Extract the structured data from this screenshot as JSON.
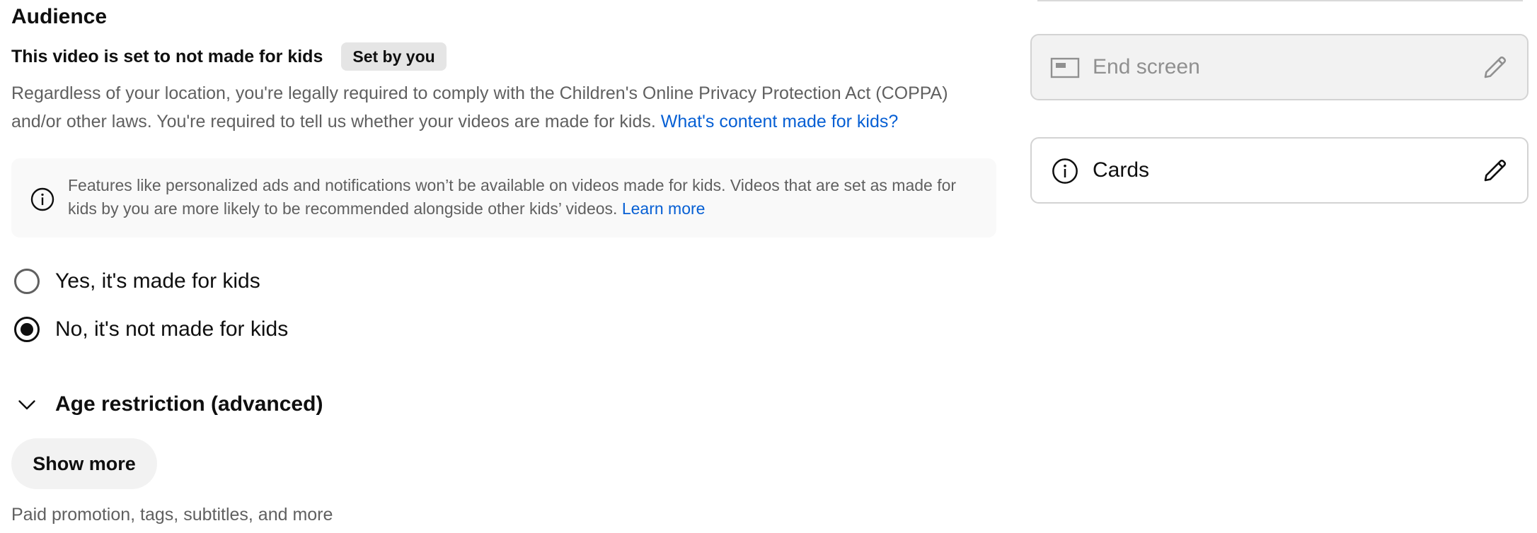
{
  "audience": {
    "heading": "Audience",
    "status_text": "This video is set to not made for kids",
    "status_badge": "Set by you",
    "description": "Regardless of your location, you're legally required to comply with the Children's Online Privacy Protection Act (COPPA) and/or other laws. You're required to tell us whether your videos are made for kids.",
    "description_link": "What's content made for kids?",
    "info_text": "Features like personalized ads and notifications won’t be available on videos made for kids. Videos that are set as made for kids by you are more likely to be recommended alongside other kids’ videos.",
    "info_link": "Learn more",
    "options": [
      {
        "label": "Yes, it's made for kids",
        "selected": false
      },
      {
        "label": "No, it's not made for kids",
        "selected": true
      }
    ]
  },
  "age_restriction": {
    "label": "Age restriction (advanced)",
    "icon": "chevron-down-icon"
  },
  "show_more": {
    "label": "Show more",
    "caption": "Paid promotion, tags, subtitles, and more"
  },
  "side_panel": {
    "end_screen": {
      "label": "End screen",
      "icon": "end-screen-icon",
      "disabled": true
    },
    "cards": {
      "label": "Cards",
      "icon": "info-icon"
    }
  },
  "colors": {
    "text_primary": "#0f0f0f",
    "text_secondary": "#606060",
    "link": "#065fd4",
    "badge_bg": "#e5e5e5",
    "info_bg": "#f9f9f9",
    "button_bg": "#f2f2f2",
    "disabled_text": "#909090"
  }
}
